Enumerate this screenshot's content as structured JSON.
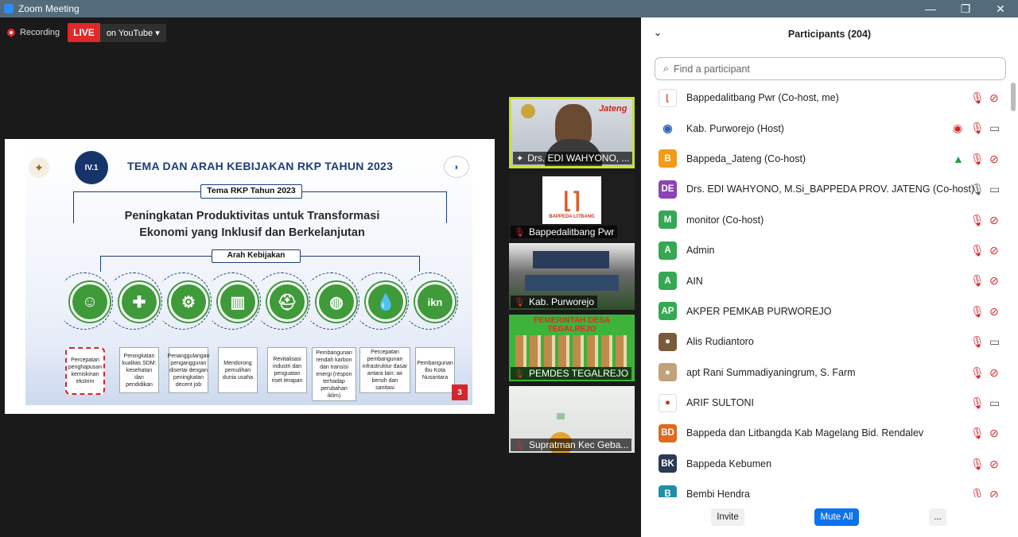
{
  "window": {
    "title": "Zoom Meeting",
    "minimize": "—",
    "maximize": "❐",
    "close": "✕"
  },
  "recording": {
    "label": "Recording",
    "live": "LIVE",
    "platform": "on YouTube ▾"
  },
  "slide": {
    "section": "IV.1",
    "title": "TEMA DAN ARAH KEBIJAKAN RKP TAHUN 2023",
    "tema_label": "Tema RKP Tahun 2023",
    "headline_1": "Peningkatan Produktivitas untuk Transformasi",
    "headline_2": "Ekonomi yang Inklusif dan Berkelanjutan",
    "arah_label": "Arah Kebijakan",
    "items": [
      "Percepatan penghapusan kemiskinan ekstrim",
      "Peningkatan kualitas SDM: kesehatan dan pendidikan",
      "Penanggulangan pengangguran disertai dengan peningkatan decent job",
      "Mendorong pemulihan dunia usaha",
      "Revitalisasi industri dan penguatan riset terapan",
      "Pembangunan rendah karbon dan transisi energi (respon terhadap perubahan iklim)",
      "Percepatan pembangunan infrastruktur dasar antara lain: air bersih dan sanitasi",
      "Pembangunan Ibu Kota Nusantara"
    ],
    "icon_8": "ikn",
    "page": "3"
  },
  "video_tiles": [
    "Drs. EDI WAHYONO, ...",
    "Bappedalitbang Pwr",
    "Kab. Purworejo",
    "PEMDES TEGALREJO ...",
    "Supratman Kec Geba..."
  ],
  "tile_texts": {
    "logo": "BAPPEDA LITBANG",
    "village": "PEMERINTAH DESA TEGALREJO",
    "jateng": "Jateng"
  },
  "participants": {
    "header": "Participants (204)",
    "search_placeholder": "Find a participant",
    "list": [
      {
        "initials": "",
        "name": "Bappedalitbang Pwr (Co-host, me)",
        "color": "#ffffff"
      },
      {
        "initials": "",
        "name": "Kab. Purworejo (Host)",
        "color": "#ffffff"
      },
      {
        "initials": "B",
        "name": "Bappeda_Jateng (Co-host)",
        "color": "#f39a1a"
      },
      {
        "initials": "DE",
        "name": "Drs. EDI WAHYONO, M.Si_BAPPEDA PROV. JATENG (Co-host)",
        "color": "#8b44b5"
      },
      {
        "initials": "M",
        "name": "monitor (Co-host)",
        "color": "#34a853"
      },
      {
        "initials": "A",
        "name": "Admin",
        "color": "#34a853"
      },
      {
        "initials": "A",
        "name": "AIN",
        "color": "#34a853"
      },
      {
        "initials": "AP",
        "name": "AKPER PEMKAB PURWOREJO",
        "color": "#34a853"
      },
      {
        "initials": "",
        "name": "Alis Rudiantoro",
        "color": "#7a5a3c"
      },
      {
        "initials": "",
        "name": "apt Rani Summadiyaningrum, S. Farm",
        "color": "#c2a27a"
      },
      {
        "initials": "",
        "name": "ARIF SULTONI",
        "color": "#ffffff"
      },
      {
        "initials": "BD",
        "name": "Bappeda dan Litbangda Kab Magelang Bid. Rendalev",
        "color": "#e06a1d"
      },
      {
        "initials": "BK",
        "name": "Bappeda Kebumen",
        "color": "#2b3a55"
      },
      {
        "initials": "B",
        "name": "Bembi Hendra",
        "color": "#1f8fa8"
      }
    ],
    "invite": "Invite",
    "mute_all": "Mute All",
    "more": "..."
  }
}
